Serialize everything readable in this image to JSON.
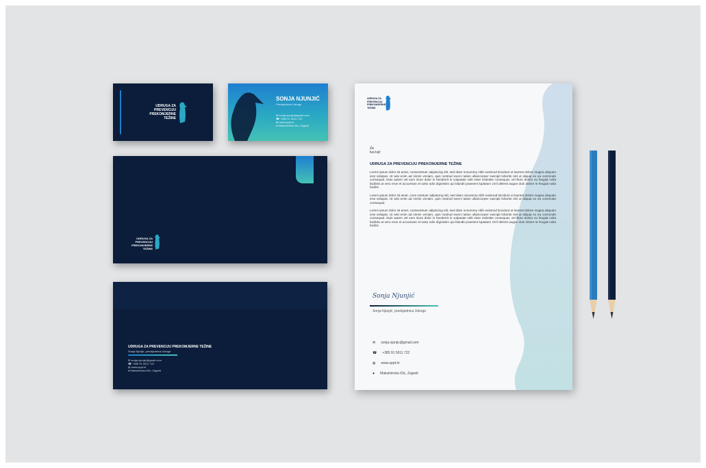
{
  "colors": {
    "navy": "#0b1d3a",
    "accent_blue": "#1f7fd0",
    "accent_teal": "#44c2b5",
    "paper": "#f7f8f9",
    "backdrop": "#e3e4e6"
  },
  "brand": {
    "logo_lines": [
      "UDRUGA ZA",
      "PREVENCIJU",
      "PREKOMJERNE",
      "TEŽINE"
    ],
    "logo_icon": "penguin-icon"
  },
  "business_card_back": {
    "name": "SONJA NJUNJIĆ",
    "role": "Predsjednica Udruge"
  },
  "envelope": {
    "heading": "UDRUGA ZA PREVENCIJU PREKOMJERNE TEŽINE",
    "subheading": "Sonja Njunjić, predsjednica Udruge"
  },
  "letterhead": {
    "to_label": "Za",
    "to_name": "Ivo Ivić",
    "title": "UDRUGA ZA PREVENCIJU PREKOMJERNE TEŽINE",
    "paragraph_1": "Lorem ipsum dolor sit amet, consectetuer adipiscing elit, sed diam nonummy nibh euismod tincidunt ut laoreet dolore magna aliquam erat volutpat. Ut wisi enim ad minim veniam, quis nostrud exerci tation ullamcorper suscipit lobortis nisl ut aliquip ex ea commodo consequat. Duis autem vel eum iriure dolor in hendrerit in vulputate velit esse molestie consequat, vel illum dolore eu feugiat nulla facilisis at vero eros et accumsan et iusto odio dignissim qui blandit praesent luptatum zzril delenit augue duis dolore te feugait nulla facilisi.",
    "paragraph_2": "Lorem ipsum dolor sit amet, cons ectetuer adipiscing elit, sed diam nonummy nibh euismod tincidunt ut laoreet dolore magna aliquam erat volutpat. Ut wisi enim ad minim veniam, quis nostrud exerci tation ullamcorper suscipit lobortis nisl ut aliquip ex ea commodo consequat.",
    "paragraph_3": "Lorem ipsum dolor sit amet, consectetuer adipiscing elit, sed diam nonummy nibh euismod tincidunt ut laoreet dolore magna aliquam erat volutpat. Ut wisi enim ad minim veniam, quis nostrud exerci tation ullamcorper suscipit lobortis nisl ut aliquip ex ea commodo consequat. Duis autem vel eum iriure dolor in hendrerit in vulputate velit esse molestie consequat, vel illum dolore eu feugiat nulla facilisis at vero eros et accumsan et iusto odio dignissim qui blandit praesent luptatum zzril delenit augue duis dolore te feugait nulla facilisi.",
    "signature_script": "Sonja Njunjić",
    "signature_caption": "Sonja Njunjić, predsjednica Udruge",
    "contacts": [
      {
        "icon": "mail-icon",
        "text": "sonja.njunjic@gmail.com"
      },
      {
        "icon": "phone-icon",
        "text": "+385 91 5011 722"
      },
      {
        "icon": "globe-icon",
        "text": "www.uppt.hr"
      },
      {
        "icon": "pin-icon",
        "text": "Maksimirska 63c, Zagreb"
      }
    ]
  }
}
